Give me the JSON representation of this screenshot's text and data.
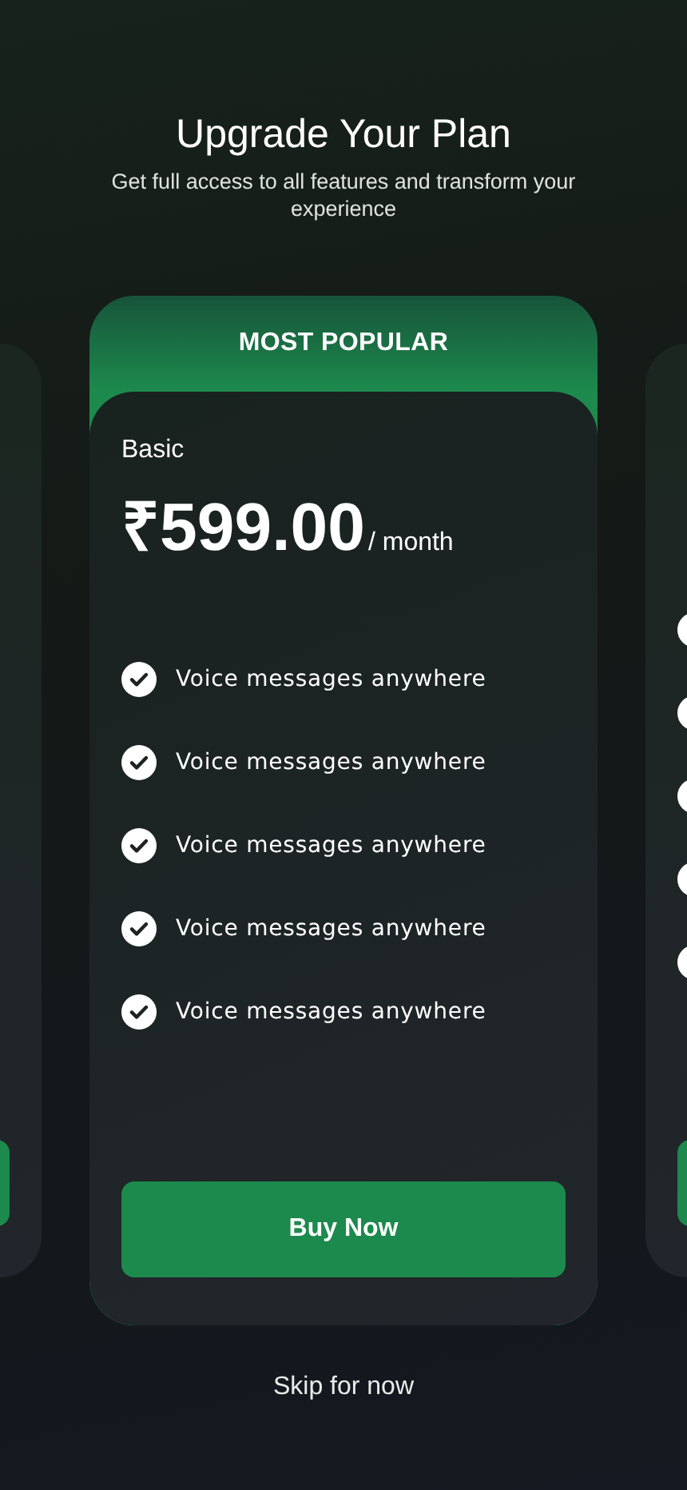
{
  "header": {
    "title": "Upgrade Your Plan",
    "subtitle": "Get full access to all features and transform your experience"
  },
  "plan": {
    "badge": "MOST POPULAR",
    "name": "Basic",
    "price": "₹599.00",
    "period": "/ month",
    "features": [
      "Voice messages anywhere",
      "Voice messages anywhere",
      "Voice messages anywhere",
      "Voice messages anywhere",
      "Voice messages anywhere"
    ],
    "button": "Buy Now"
  },
  "skip_link": "Skip for now"
}
